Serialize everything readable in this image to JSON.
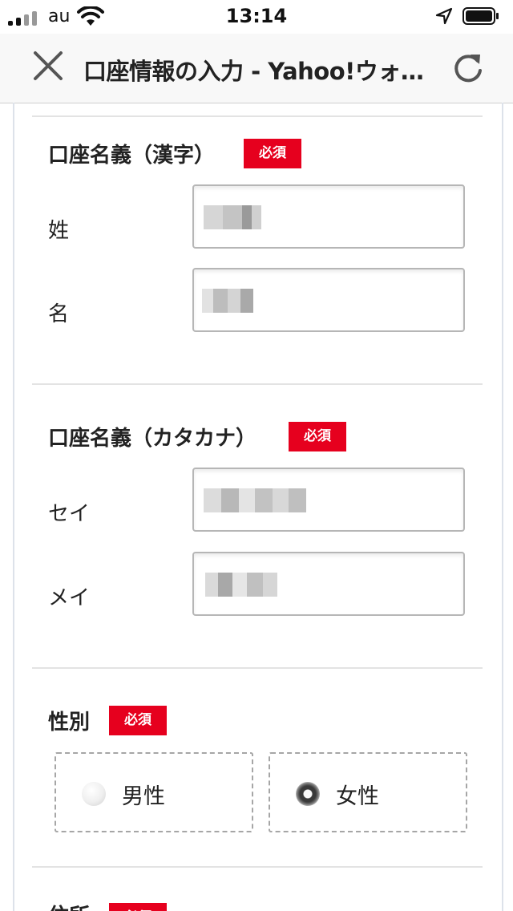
{
  "status_bar": {
    "carrier": "au",
    "time": "13:14"
  },
  "nav": {
    "title": "口座情報の入力 - Yahoo!ウォ…"
  },
  "sections": {
    "kanji": {
      "title": "口座名義（漢字）",
      "badge": "必須",
      "fields": [
        {
          "label": "姓"
        },
        {
          "label": "名"
        }
      ]
    },
    "katakana": {
      "title": "口座名義（カタカナ）",
      "badge": "必須",
      "fields": [
        {
          "label": "セイ"
        },
        {
          "label": "メイ"
        }
      ]
    },
    "gender": {
      "title": "性別",
      "badge": "必須",
      "options": [
        {
          "label": "男性",
          "selected": false
        },
        {
          "label": "女性",
          "selected": true
        }
      ]
    },
    "next": {
      "title": "住所",
      "badge": "必須"
    }
  },
  "colors": {
    "required_badge": "#e6001e",
    "navbar_bg": "#f8f8f8"
  }
}
